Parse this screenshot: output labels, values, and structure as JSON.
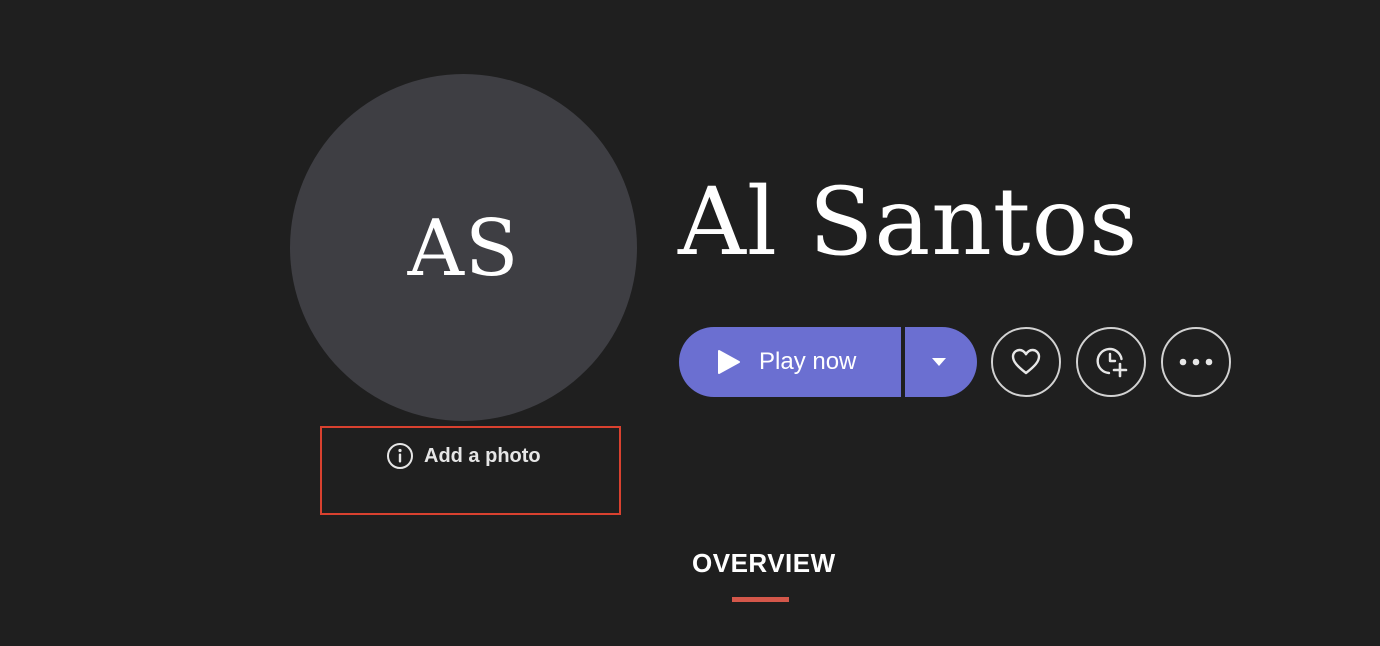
{
  "artist": {
    "name": "Al Santos",
    "initials": "AS"
  },
  "photo_hint": {
    "label": "Add a photo",
    "icon": "info-icon"
  },
  "actions": {
    "play_label": "Play now",
    "play_icon": "play-icon",
    "dropdown_icon": "caret-down-icon",
    "favorite_icon": "heart-icon",
    "watchlist_icon": "clock-plus-icon",
    "more_icon": "more-horizontal-icon"
  },
  "tabs": [
    {
      "label": "OVERVIEW",
      "active": true
    }
  ],
  "colors": {
    "background": "#1f1f1f",
    "avatar": "#3e3e43",
    "accent": "#6b6fd1",
    "highlight_border": "#d9412f",
    "tab_underline": "#d4574a"
  }
}
